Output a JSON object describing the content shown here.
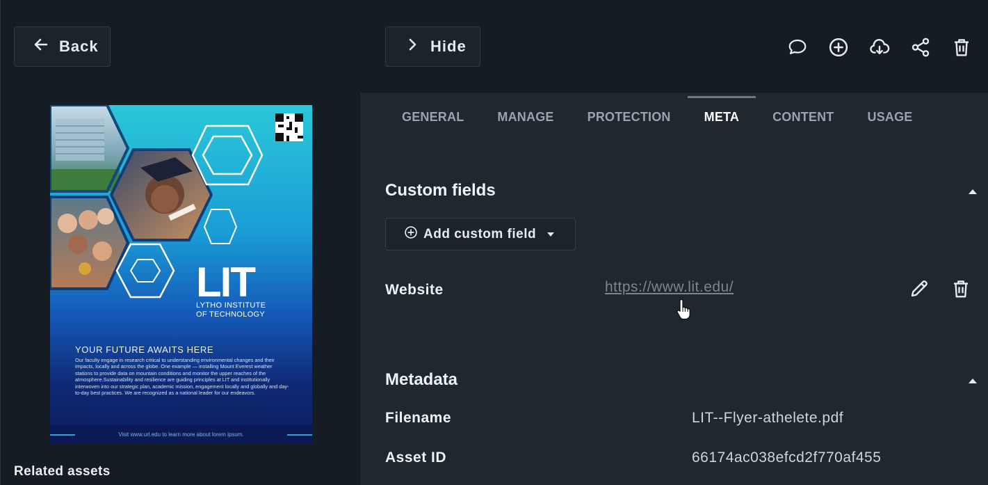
{
  "left_panel": {
    "back_label": "Back",
    "related_label": "Related assets"
  },
  "preview": {
    "logo_text": "LIT",
    "institute_line1": "LYTHO INSTITUTE",
    "institute_line2": "OF TECHNOLOGY",
    "heading": "YOUR FUTURE AWAITS HERE",
    "body": "Our faculty engage in research critical to understanding environmental changes and their impacts, locally and across the globe. One example — installing Mount Everest weather stations to provide data on mountain conditions and monitor the upper reaches of the atmosphere.Sustainability and resilience are guiding principles at LIT and institutionally interwoven into our strategic plan, academic mission, engagement locally and globally and day-to-day best practices. We are recognized as a national leader for our endeavors.",
    "footer": "Visit www.url.edu to learn more about lorem ipsum."
  },
  "header": {
    "hide_label": "Hide",
    "icons": [
      "comment-icon",
      "add-circle-icon",
      "cloud-download-icon",
      "share-icon",
      "trash-icon"
    ]
  },
  "tabs": [
    {
      "label": "GENERAL",
      "active": false
    },
    {
      "label": "MANAGE",
      "active": false
    },
    {
      "label": "PROTECTION",
      "active": false
    },
    {
      "label": "META",
      "active": true
    },
    {
      "label": "CONTENT",
      "active": false
    },
    {
      "label": "USAGE",
      "active": false
    }
  ],
  "custom_fields": {
    "title": "Custom fields",
    "add_label": "Add custom field",
    "rows": [
      {
        "label": "Website",
        "value": "https://www.lit.edu/"
      }
    ]
  },
  "metadata": {
    "title": "Metadata",
    "rows": [
      {
        "label": "Filename",
        "value": "LIT--Flyer-athelete.pdf"
      },
      {
        "label": "Asset ID",
        "value": "66174ac038efcd2f770af455"
      }
    ]
  },
  "colors": {
    "panel_bg": "#1f272f",
    "page_bg": "#151c23",
    "link": "#7d858d"
  }
}
